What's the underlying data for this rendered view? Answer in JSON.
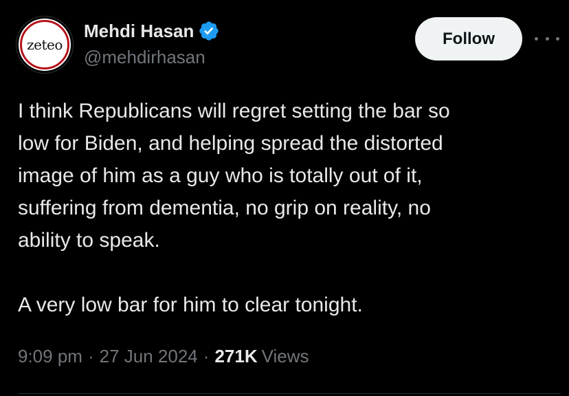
{
  "author": {
    "avatar_text": "zeteo",
    "display_name": "Mehdi Hasan",
    "handle": "@mehdirhasan",
    "verified_icon": "verified-badge-icon"
  },
  "actions": {
    "follow_label": "Follow",
    "more_icon": "more-horizontal-icon"
  },
  "tweet": {
    "paragraph_1": "I think Republicans will regret setting the bar so\nlow for Biden, and helping spread the distorted\nimage of him as a guy who is totally out of it,\nsuffering from dementia, no grip on reality, no\nability to speak.",
    "paragraph_2": "A very low bar for him to clear tonight."
  },
  "meta": {
    "time": "9:09 pm",
    "separator": "·",
    "date": "27 Jun 2024",
    "views_count": "271K",
    "views_label": "Views"
  },
  "colors": {
    "background": "#000000",
    "text_primary": "#e7e9ea",
    "text_secondary": "#71767b",
    "verified_blue": "#1d9bf0",
    "follow_bg": "#eff3f4",
    "avatar_ring": "#b5121b"
  }
}
